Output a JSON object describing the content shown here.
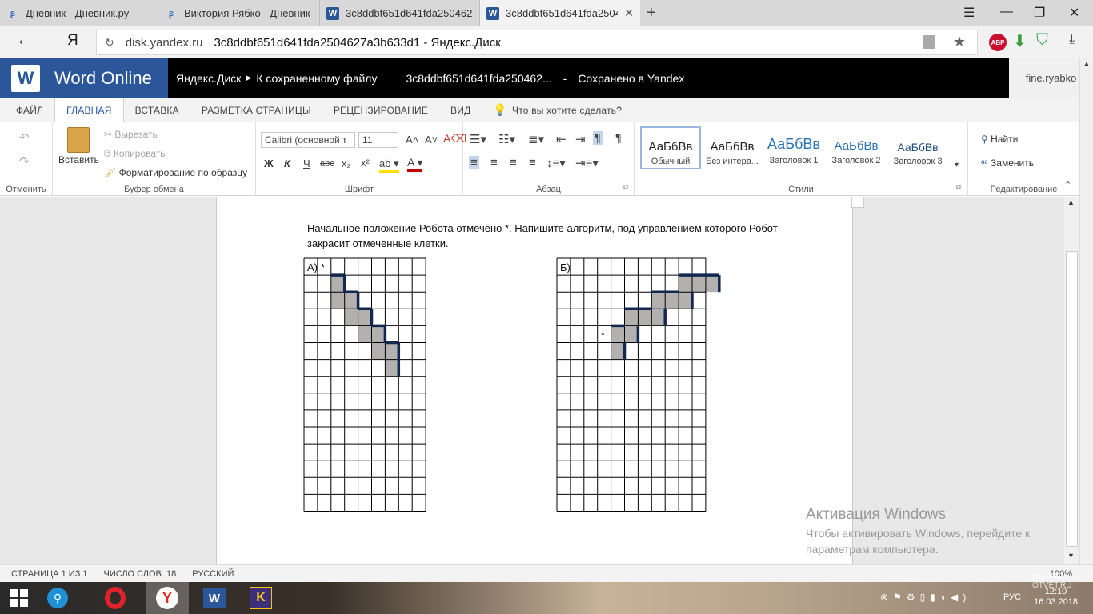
{
  "browser": {
    "tabs": [
      {
        "title": "Дневник - Дневник.ру",
        "favicon": "dnevnik-icon"
      },
      {
        "title": "Виктория Рябко - Дневник",
        "favicon": "dnevnik-icon"
      },
      {
        "title": "3c8ddbf651d641fda2504627",
        "favicon": "word-doc-icon"
      },
      {
        "title": "3c8ddbf651d641fda25046",
        "favicon": "word-doc-icon",
        "active": true
      }
    ],
    "url_domain": "disk.yandex.ru",
    "url_title": "3c8ddbf651d641fda2504627a3b633d1 - Яндекс.Диск",
    "yandex_letter": "Я",
    "adblock_label": "ABP"
  },
  "word": {
    "app_name": "Word Online",
    "breadcrumb_disk": "Яндекс.Диск",
    "breadcrumb_back": "К сохраненному файлу",
    "file_name": "3c8ddbf651d641fda250462...",
    "separator": "-",
    "save_status": "Сохранено в Yandex",
    "user": "fine.ryabko"
  },
  "menu": [
    "ФАЙЛ",
    "ГЛАВНАЯ",
    "ВСТАВКА",
    "РАЗМЕТКА СТРАНИЦЫ",
    "РЕЦЕНЗИРОВАНИЕ",
    "ВИД"
  ],
  "tell_me": "Что вы хотите сделать?",
  "ribbon": {
    "undo_group": "Отменить",
    "paste": "Вставить",
    "cut": "Вырезать",
    "copy": "Копировать",
    "format_painter": "Форматирование по образцу",
    "clipboard_group": "Буфер обмена",
    "font_name": "Calibri (основной т",
    "font_size": "11",
    "font_group": "Шрифт",
    "bold": "Ж",
    "italic": "К",
    "underline": "Ч",
    "strike": "abc",
    "paragraph_group": "Абзац",
    "styles": [
      {
        "preview": "АаБбВв",
        "name": "Обычный"
      },
      {
        "preview": "АаБбВв",
        "name": "Без интерв..."
      },
      {
        "preview": "АаБбВв",
        "name": "Заголовок 1"
      },
      {
        "preview": "АаБбВв",
        "name": "Заголовок 2"
      },
      {
        "preview": "АаБбВв",
        "name": "Заголовок 3"
      }
    ],
    "styles_group": "Стили",
    "find": "Найти",
    "replace": "Заменить",
    "editing_group": "Редактирование"
  },
  "document": {
    "text": "Начальное положение Робота отмечено *. Напишите алгоритм, под управлением которого Робот закрасит отмеченные клетки.",
    "grid_a_label": "А)",
    "grid_b_label": "Б)",
    "star": "*",
    "grid_a": {
      "cols": 9,
      "rows": 15,
      "start": [
        1,
        0
      ],
      "shaded": [
        [
          2,
          1
        ],
        [
          2,
          2
        ],
        [
          3,
          2
        ],
        [
          3,
          3
        ],
        [
          4,
          3
        ],
        [
          4,
          4
        ],
        [
          5,
          4
        ],
        [
          5,
          5
        ],
        [
          6,
          5
        ],
        [
          6,
          6
        ]
      ]
    },
    "grid_b": {
      "cols": 11,
      "rows": 15,
      "start": [
        3,
        4
      ],
      "shaded": [
        [
          4,
          4
        ],
        [
          4,
          5
        ],
        [
          5,
          4
        ],
        [
          5,
          3
        ],
        [
          6,
          3
        ],
        [
          7,
          3
        ],
        [
          7,
          2
        ],
        [
          8,
          2
        ],
        [
          9,
          2
        ],
        [
          9,
          1
        ],
        [
          10,
          1
        ],
        [
          11,
          1
        ]
      ]
    }
  },
  "activation": {
    "title": "Активация Windows",
    "text": "Чтобы активировать Windows, перейдите к параметрам компьютера."
  },
  "status": {
    "page": "СТРАНИЦА 1 ИЗ 1",
    "words": "ЧИСЛО СЛОВ: 18",
    "lang": "РУССКИЙ",
    "zoom": "100%"
  },
  "taskbar": {
    "lang": "РУС",
    "time": "12:10",
    "date": "16.03.2018",
    "watermark": "ONLINE-OTVET.RU",
    "k_app": "K"
  }
}
